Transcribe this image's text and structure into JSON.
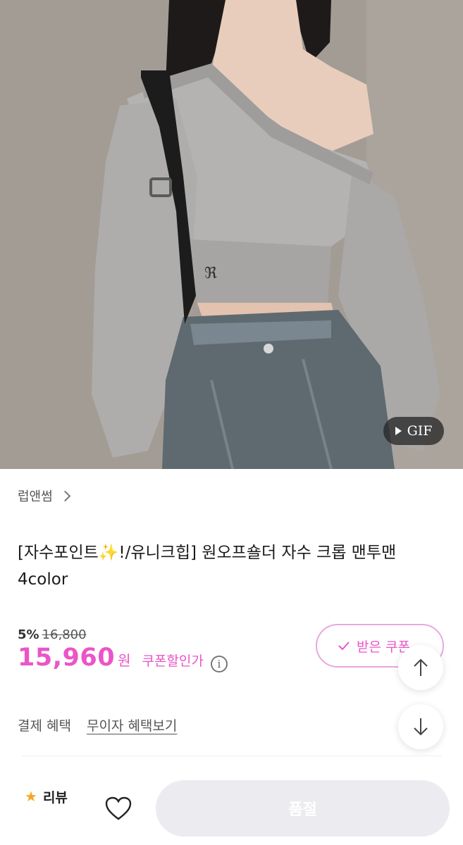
{
  "product": {
    "gif_label": "GIF",
    "brand": "럽앤썸",
    "title_line1": "[자수포인트✨!/유니크힙] 원오프숄더 자수 크롭 맨투맨",
    "title_line2": "4color",
    "discount_rate": "5%",
    "original_price": "16,800",
    "sale_price": "15,960",
    "currency": "원",
    "coupon_price_label": "쿠폰할인가",
    "info_icon": "i"
  },
  "coupon_button": {
    "label": "받은 쿠폰"
  },
  "payment": {
    "label": "결제 혜택",
    "link": "무이자 혜택보기"
  },
  "bottom_bar": {
    "review_label": "리뷰",
    "buy_label": "품절"
  },
  "colors": {
    "accent": "#ea55c8",
    "coupon_border": "#e9a8dc",
    "soldout_bg": "#ececf0",
    "star": "#f5a623"
  }
}
